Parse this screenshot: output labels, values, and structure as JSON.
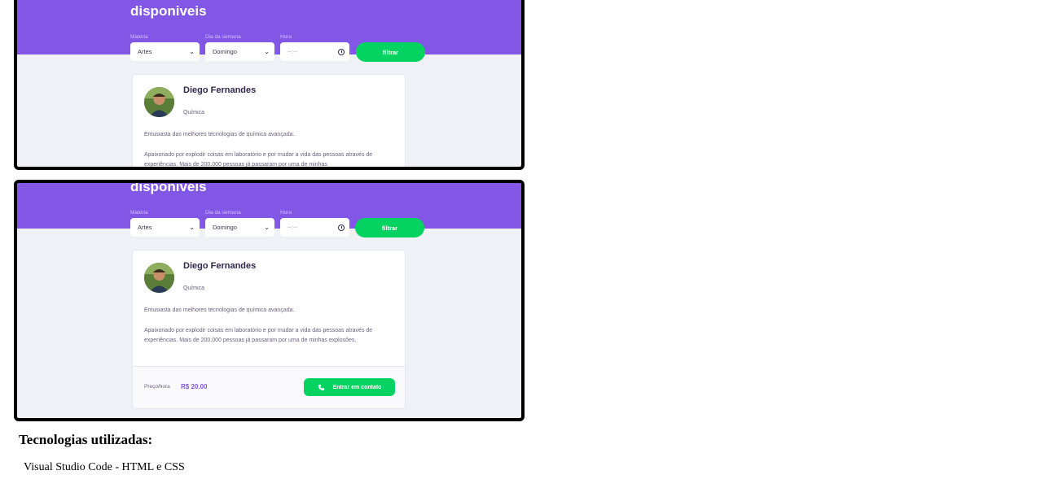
{
  "screenshots": [
    {
      "hero_title": "disponiveis",
      "filters": {
        "subject_label": "Matéria",
        "subject_value": "Artes",
        "weekday_label": "Dia da semana",
        "weekday_value": "Domingo",
        "time_label": "Hora",
        "time_value": "--:--",
        "submit_label": "filtrar"
      },
      "teacher": {
        "name": "Diego Fernandes",
        "subject": "Química",
        "bio_1": "Entusiasta das melhores tecnologias de química avançada.",
        "bio_2": "Apaixonado por explodir coisas em laboratório e por mudar a vida das pessoas através de experiências. Mais de 200.000 pessoas já passaram por uma de minhas"
      }
    },
    {
      "hero_title": "disponiveis",
      "filters": {
        "subject_label": "Matéria",
        "subject_value": "Artes",
        "weekday_label": "Dia da semana",
        "weekday_value": "Domingo",
        "time_label": "Hora",
        "time_value": "--:--",
        "submit_label": "filtrar"
      },
      "teacher": {
        "name": "Diego Fernandes",
        "subject": "Química",
        "bio_1": "Entusiasta das melhores tecnologias de química avançada.",
        "bio_2": "Apaixonado por explodir coisas em laboratório e por mudar a vida das pessoas através de experiências. Mais de 200.000 pessoas já passaram por uma de minhas explosões.",
        "price_label": "Preço/hora",
        "price_value": "R$ 20.00",
        "contact_label": "Entrar em contato"
      }
    }
  ],
  "technologies": {
    "heading": "Tecnologias utilizadas:",
    "item": "Visual Studio Code - HTML e CSS"
  },
  "icons": [
    "chevron-down-icon",
    "clock-icon",
    "whatsapp-icon",
    "avatar"
  ],
  "colors": {
    "primary": "#8257e5",
    "secondary": "#04d361",
    "background": "#f0f0f7",
    "text_title": "#32264d",
    "text_base": "#6a6180"
  }
}
